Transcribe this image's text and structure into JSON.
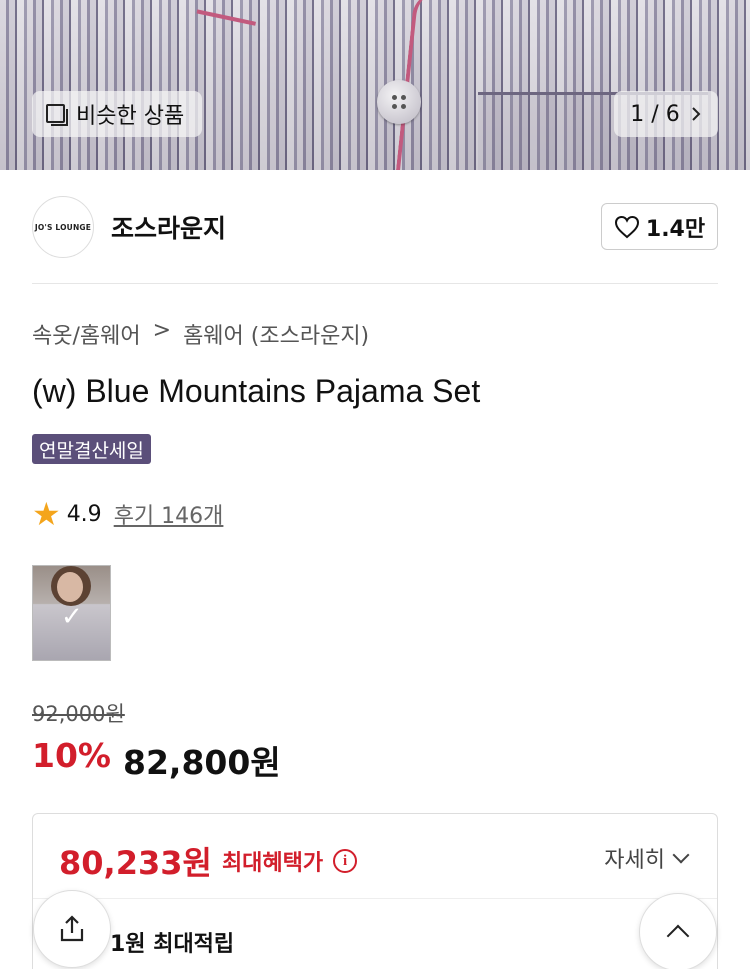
{
  "hero": {
    "similar_label": "비슷한 상품",
    "counter": "1 / 6"
  },
  "brand": {
    "logo_text": "JO'S LOUNGE",
    "name": "조스라운지",
    "like_count": "1.4만"
  },
  "product": {
    "breadcrumb": [
      "속옷/홈웨어",
      ">",
      "홈웨어 (조스라운지)"
    ],
    "title": "(w) Blue Mountains Pajama Set",
    "badge": "연말결산세일",
    "rating": "4.9",
    "reviews": "후기 146개",
    "original_price": "92,000원",
    "discount": "10%",
    "sale_price": "82,800원"
  },
  "benefit": {
    "max_price": "80,233원",
    "max_label": "최대혜택가",
    "info_icon": "i",
    "detail_label": "자세히",
    "points": "1원 최대적립"
  },
  "colors": {
    "accent_red": "#d21e2b",
    "badge_purple": "#5b4f7a",
    "star": "#f4a51c"
  },
  "icons": {
    "similar": "similar-products-icon",
    "heart": "heart-icon",
    "star": "star-icon",
    "share": "share-icon",
    "top": "chevron-up-icon",
    "detail": "chevron-down-icon"
  }
}
